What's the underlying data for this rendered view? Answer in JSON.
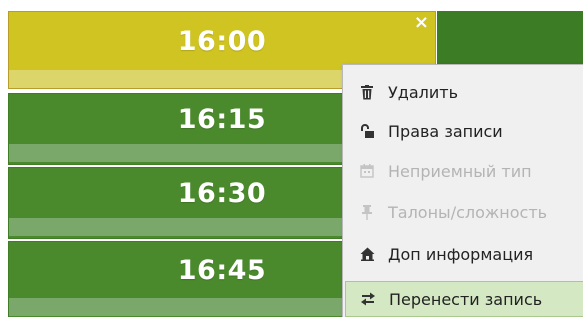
{
  "slots": [
    {
      "time": "16:00",
      "state": "selected",
      "close_label": "×"
    },
    {
      "time": "16:15",
      "state": "free"
    },
    {
      "time": "16:30",
      "state": "free"
    },
    {
      "time": "16:45",
      "state": "free"
    }
  ],
  "context_menu": {
    "items": [
      {
        "label": "Удалить",
        "icon": "trash-icon",
        "enabled": true
      },
      {
        "label": "Права записи",
        "icon": "lock-icon",
        "enabled": true
      },
      {
        "label": "Неприемный тип",
        "icon": "calendar-icon",
        "enabled": false
      },
      {
        "label": "Талоны/сложность",
        "icon": "pin-icon",
        "enabled": false
      },
      {
        "label": "Доп информация",
        "icon": "house-icon",
        "enabled": true
      },
      {
        "label": "Перенести запись",
        "icon": "transfer-arrows-icon",
        "enabled": true,
        "highlighted": true
      }
    ]
  },
  "colors": {
    "selected_slot": "#cfc421",
    "free_slot": "#4a8a2c",
    "menu_highlight": "#d5e8c4"
  }
}
